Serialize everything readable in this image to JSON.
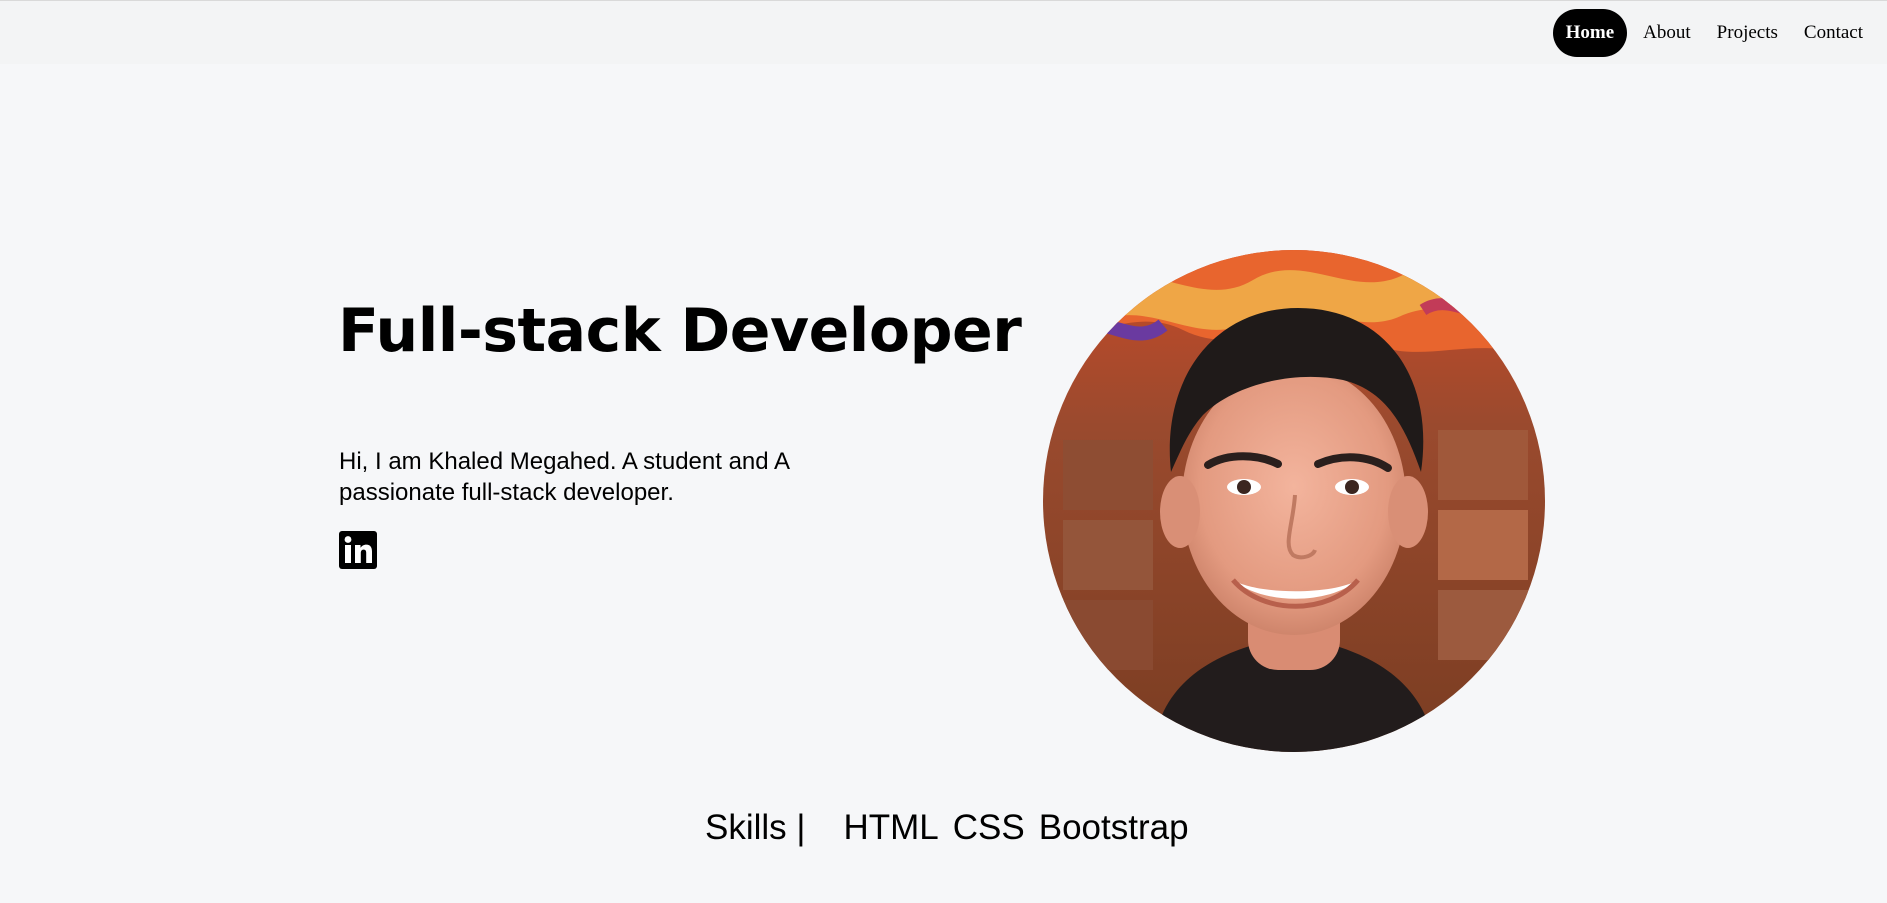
{
  "nav": {
    "items": [
      {
        "label": "Home",
        "active": true
      },
      {
        "label": "About",
        "active": false
      },
      {
        "label": "Projects",
        "active": false
      },
      {
        "label": "Contact",
        "active": false
      }
    ]
  },
  "hero": {
    "title": "Full-stack Developer",
    "intro": "Hi, I am Khaled Megahed. A student and A passionate full-stack developer.",
    "social_icon": "linkedin-icon",
    "portrait_icon": "profile-photo"
  },
  "skills": {
    "label": "Skills |",
    "items": [
      "HTML",
      "CSS",
      "Bootstrap"
    ]
  },
  "colors": {
    "page_background": "#f6f7f9",
    "nav_background": "#f3f4f5",
    "accent": "#000000"
  }
}
